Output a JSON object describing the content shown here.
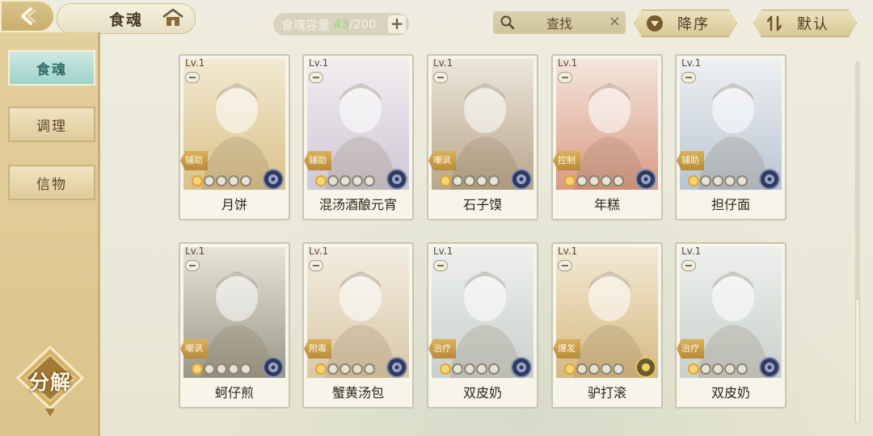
{
  "header": {
    "title": "食魂",
    "capacity_label": "食魂容量",
    "capacity_current": "43",
    "capacity_sep": "/",
    "capacity_max": "200",
    "plus_label": "+",
    "search_label": "查找",
    "search_clear": "×",
    "sort_label": "降序",
    "default_label": "默认"
  },
  "sidebar": {
    "tabs": [
      {
        "label": "食魂",
        "active": true
      },
      {
        "label": "调理",
        "active": false
      },
      {
        "label": "信物",
        "active": false
      }
    ],
    "decompose_label": "分解"
  },
  "cards": [
    {
      "level": "Lv.1",
      "role": "辅助",
      "name": "月饼",
      "stars": 1,
      "element": "night"
    },
    {
      "level": "Lv.1",
      "role": "辅助",
      "name": "混汤酒酿元宵",
      "stars": 1,
      "element": "night"
    },
    {
      "level": "Lv.1",
      "role": "嘲讽",
      "name": "石子馍",
      "stars": 1,
      "element": "night"
    },
    {
      "level": "Lv.1",
      "role": "控制",
      "name": "年糕",
      "stars": 1,
      "element": "night"
    },
    {
      "level": "Lv.1",
      "role": "辅助",
      "name": "担仔面",
      "stars": 1,
      "element": "night"
    },
    {
      "level": "Lv.1",
      "role": "嘲讽",
      "name": "蚵仔煎",
      "stars": 1,
      "element": "night"
    },
    {
      "level": "Lv.1",
      "role": "附毒",
      "name": "蟹黄汤包",
      "stars": 1,
      "element": "night"
    },
    {
      "level": "Lv.1",
      "role": "治疗",
      "name": "双皮奶",
      "stars": 1,
      "element": "night"
    },
    {
      "level": "Lv.1",
      "role": "爆发",
      "name": "驴打滚",
      "stars": 1,
      "element": "sun"
    },
    {
      "level": "Lv.1",
      "role": "治疗",
      "name": "双皮奶",
      "stars": 1,
      "element": "night"
    }
  ],
  "colors": {
    "background": "#ece9d6",
    "sidebar": "#dcc48c",
    "active_tab": "#9fd2c9",
    "role_tag": "#c79a45",
    "capacity_current": "#8fdc6a"
  },
  "icons": [
    "back-arrow-icon",
    "home-icon",
    "search-icon",
    "sort-down-icon",
    "sort-default-icon",
    "element-icon"
  ]
}
